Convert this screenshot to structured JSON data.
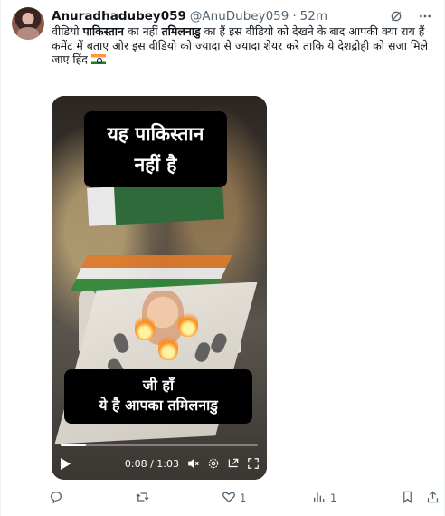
{
  "tweet": {
    "author_name": "Anuradhadubey059",
    "handle": "@AnuDubey059",
    "separator": "·",
    "time": "52m",
    "text_part1": "वीडियो ",
    "text_bold1": "पाकिस्तान",
    "text_part2": " का नहीं ",
    "text_bold2": "तमिलनाडु",
    "text_part3": " का हैं इस वीडियो को देखने के बाद आपकी क्या राय हैं कमेंट में बताए ओर इस वीडियो को ज्यादा से ज्यादा शेयर करे ताकि ये देशद्रोही को सजा मिले",
    "text_line2": "जाए हिंद"
  },
  "video": {
    "caption_top_line1": "यह पाकिस्तान",
    "caption_top_line2": "नहीं है",
    "caption_bottom_line1": "जी हाँ",
    "caption_bottom_line2": "ये है आपका तमिलनाडु",
    "current_time": "0:08",
    "duration": "1:03",
    "time_separator": " / ",
    "progress_fraction": 0.127
  },
  "actions": {
    "replies": "",
    "retweets": "",
    "likes": "1",
    "views": "1"
  },
  "icons": {
    "header": [
      "grok-icon",
      "more-icon"
    ],
    "video": [
      "play-icon",
      "volume-mute-icon",
      "settings-icon",
      "pip-icon",
      "fullscreen-icon"
    ],
    "actions": [
      "reply-icon",
      "retweet-icon",
      "like-icon",
      "views-icon",
      "bookmark-icon",
      "share-icon"
    ]
  },
  "colors": {
    "text": "#0f1419",
    "muted": "#536471",
    "caption_bg": "#000000"
  }
}
